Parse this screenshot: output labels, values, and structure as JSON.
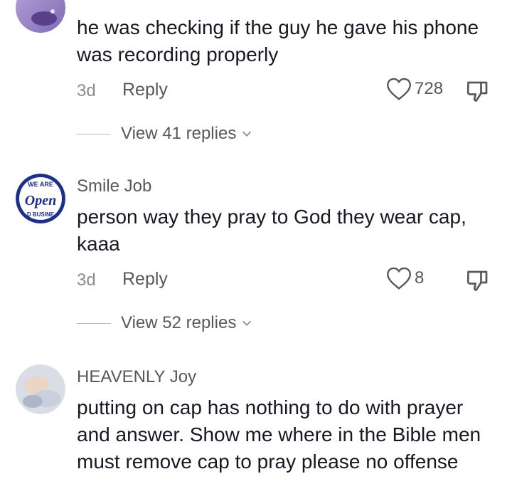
{
  "comments": [
    {
      "username": "",
      "text": "he was checking if the guy he gave his phone was recording properly",
      "age": "3d",
      "reply_label": "Reply",
      "likes": "728",
      "view_replies": "View 41 replies"
    },
    {
      "username": "Smile Job",
      "avatar_text": "Open",
      "avatar_arc_top": "WE ARE",
      "avatar_arc_bottom": "D BUSINE",
      "text": "person way they pray to God they wear cap, kaaa",
      "age": "3d",
      "reply_label": "Reply",
      "likes": "8",
      "view_replies": "View 52 replies"
    },
    {
      "username": "HEAVENLY Joy",
      "text": "putting on cap has nothing to do with prayer and answer. Show me where in the Bible men must remove cap to pray please no offense"
    }
  ],
  "icons": {
    "like": "heart-outline-icon",
    "dislike": "thumbs-down-icon",
    "expand": "chevron-down-icon"
  },
  "colors": {
    "text": "#161823",
    "secondary": "#57585d",
    "muted": "#8a8b91",
    "avatar_blue": "#1b2f8f"
  }
}
